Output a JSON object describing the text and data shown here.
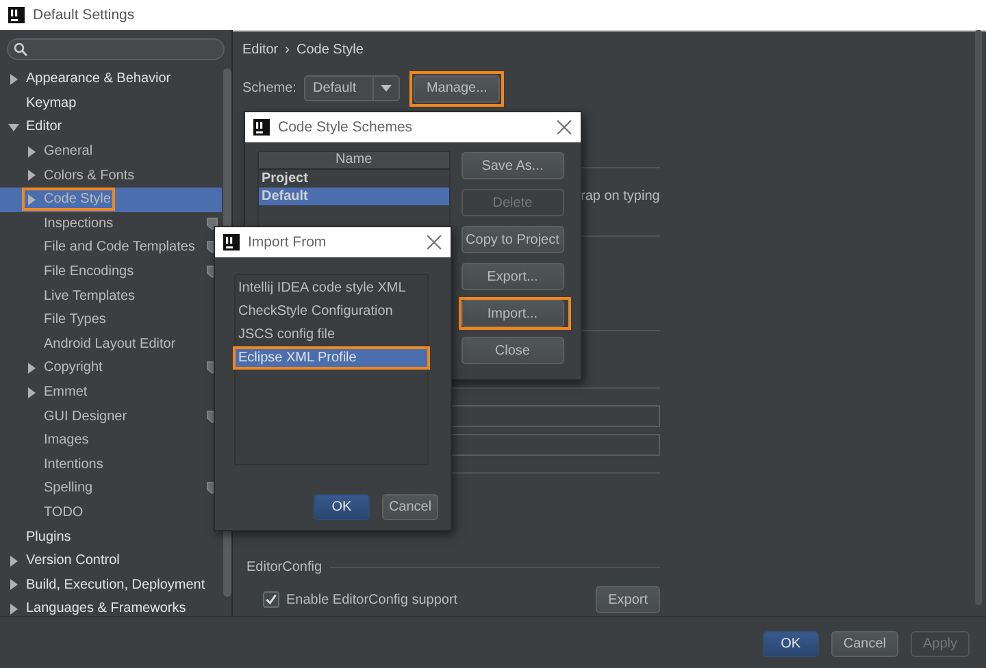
{
  "window": {
    "title": "Default Settings"
  },
  "sidebar": {
    "items": [
      {
        "label": "Appearance & Behavior",
        "kind": "folder",
        "expanded": false,
        "selected": false,
        "highlighted": false,
        "scoped": false
      },
      {
        "label": "Keymap",
        "kind": "page",
        "selected": false,
        "highlighted": false,
        "scoped": false
      },
      {
        "label": "Editor",
        "kind": "folder",
        "expanded": true,
        "selected": false,
        "highlighted": false,
        "scoped": false,
        "children": [
          {
            "label": "General",
            "kind": "folder",
            "expanded": false,
            "selected": false,
            "highlighted": false,
            "scoped": false
          },
          {
            "label": "Colors & Fonts",
            "kind": "folder",
            "expanded": false,
            "selected": false,
            "highlighted": false,
            "scoped": false
          },
          {
            "label": "Code Style",
            "kind": "folder",
            "expanded": false,
            "selected": true,
            "highlighted": true,
            "scoped": false
          },
          {
            "label": "Inspections",
            "kind": "page",
            "selected": false,
            "highlighted": false,
            "scoped": true
          },
          {
            "label": "File and Code Templates",
            "kind": "page",
            "selected": false,
            "highlighted": false,
            "scoped": true
          },
          {
            "label": "File Encodings",
            "kind": "page",
            "selected": false,
            "highlighted": false,
            "scoped": true
          },
          {
            "label": "Live Templates",
            "kind": "page",
            "selected": false,
            "highlighted": false,
            "scoped": false
          },
          {
            "label": "File Types",
            "kind": "page",
            "selected": false,
            "highlighted": false,
            "scoped": false
          },
          {
            "label": "Android Layout Editor",
            "kind": "page",
            "selected": false,
            "highlighted": false,
            "scoped": false
          },
          {
            "label": "Copyright",
            "kind": "folder",
            "expanded": false,
            "selected": false,
            "highlighted": false,
            "scoped": true
          },
          {
            "label": "Emmet",
            "kind": "folder",
            "expanded": false,
            "selected": false,
            "highlighted": false,
            "scoped": false
          },
          {
            "label": "GUI Designer",
            "kind": "page",
            "selected": false,
            "highlighted": false,
            "scoped": true
          },
          {
            "label": "Images",
            "kind": "page",
            "selected": false,
            "highlighted": false,
            "scoped": false
          },
          {
            "label": "Intentions",
            "kind": "page",
            "selected": false,
            "highlighted": false,
            "scoped": false
          },
          {
            "label": "Spelling",
            "kind": "page",
            "selected": false,
            "highlighted": false,
            "scoped": true
          },
          {
            "label": "TODO",
            "kind": "page",
            "selected": false,
            "highlighted": false,
            "scoped": false
          }
        ]
      },
      {
        "label": "Plugins",
        "kind": "page",
        "selected": false,
        "highlighted": false,
        "scoped": false
      },
      {
        "label": "Version Control",
        "kind": "folder",
        "expanded": false,
        "selected": false,
        "highlighted": false,
        "scoped": false
      },
      {
        "label": "Build, Execution, Deployment",
        "kind": "folder",
        "expanded": false,
        "selected": false,
        "highlighted": false,
        "scoped": false
      },
      {
        "label": "Languages & Frameworks",
        "kind": "folder",
        "expanded": false,
        "selected": false,
        "highlighted": false,
        "scoped": false
      }
    ]
  },
  "content": {
    "breadcrumb": {
      "parts": [
        "Editor",
        "Code Style"
      ],
      "separator": "›"
    },
    "scheme": {
      "label": "Scheme:",
      "value": "Default"
    },
    "manage_button": {
      "label": "Manage...",
      "highlighted": true
    },
    "partial_option_label": "rap on typing",
    "editorconfig": {
      "title": "EditorConfig",
      "option": {
        "label": "Enable EditorConfig support",
        "checked": true
      },
      "export_button": "Export"
    }
  },
  "schemes_dialog": {
    "title": "Code Style Schemes",
    "column": "Name",
    "rows": [
      {
        "name": "Project",
        "selected": false
      },
      {
        "name": "Default",
        "selected": true
      }
    ],
    "buttons": [
      {
        "label": "Save As...",
        "disabled": false,
        "highlighted": false
      },
      {
        "label": "Delete",
        "disabled": true,
        "highlighted": false
      },
      {
        "label": "Copy to Project",
        "disabled": false,
        "highlighted": false
      },
      {
        "label": "Export...",
        "disabled": false,
        "highlighted": false
      },
      {
        "label": "Import...",
        "disabled": false,
        "highlighted": true
      },
      {
        "label": "Close",
        "disabled": false,
        "highlighted": false
      }
    ]
  },
  "import_dialog": {
    "title": "Import From",
    "options": [
      {
        "label": "Intellij IDEA code style XML",
        "selected": false,
        "highlighted": false
      },
      {
        "label": "CheckStyle Configuration",
        "selected": false,
        "highlighted": false
      },
      {
        "label": "JSCS config file",
        "selected": false,
        "highlighted": false
      },
      {
        "label": "Eclipse XML Profile",
        "selected": true,
        "highlighted": true
      }
    ],
    "buttons": [
      {
        "label": "OK",
        "kind": "default",
        "disabled": false
      },
      {
        "label": "Cancel",
        "kind": "normal",
        "disabled": false
      }
    ]
  },
  "footer": {
    "buttons": [
      {
        "label": "OK",
        "kind": "default",
        "disabled": false
      },
      {
        "label": "Cancel",
        "kind": "normal",
        "disabled": false
      },
      {
        "label": "Apply",
        "kind": "normal",
        "disabled": true
      }
    ]
  }
}
